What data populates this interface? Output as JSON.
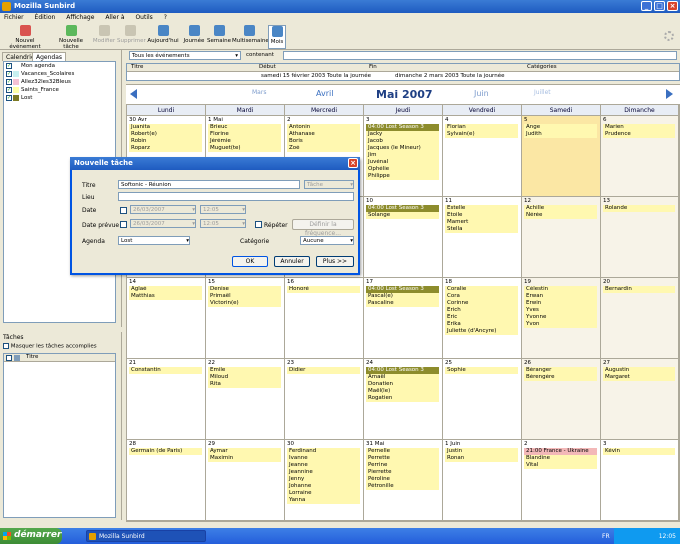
{
  "window": {
    "title": "Mozilla Sunbird"
  },
  "menu": [
    "Fichier",
    "Édition",
    "Affichage",
    "Aller à",
    "Outils",
    "?"
  ],
  "toolbar": [
    {
      "label": "Nouvel événement",
      "icon": "calendar-new-icon",
      "enabled": true
    },
    {
      "label": "Nouvelle tâche",
      "icon": "task-new-icon",
      "enabled": true
    },
    {
      "label": "Modifier",
      "icon": "edit-icon",
      "enabled": false
    },
    {
      "label": "Supprimer",
      "icon": "delete-icon",
      "enabled": false
    },
    {
      "label": "Aujourd'hui",
      "icon": "today-icon",
      "enabled": true
    },
    {
      "label": "Journée",
      "icon": "day-view-icon",
      "enabled": true
    },
    {
      "label": "Semaine",
      "icon": "week-view-icon",
      "enabled": true
    },
    {
      "label": "Multisemaine",
      "icon": "multiweek-view-icon",
      "enabled": true
    },
    {
      "label": "Mois",
      "icon": "month-view-icon",
      "enabled": true,
      "selected": true
    }
  ],
  "left": {
    "tabs": [
      "Calendrier",
      "Agendas"
    ],
    "active_tab": "Agendas",
    "calendars": [
      {
        "name": "Mon agenda",
        "color": "#ffffff"
      },
      {
        "name": "Vacances_Scolaires",
        "color": "#c7f0f0"
      },
      {
        "name": "Allez32les32Bleus",
        "color": "#f4c1d4"
      },
      {
        "name": "Saints_France",
        "color": "#ffffa8"
      },
      {
        "name": "Lost",
        "color": "#7d7a24"
      }
    ]
  },
  "tasks": {
    "title": "Tâches",
    "show_completed": "Masquer les tâches accomplies",
    "column": "Titre"
  },
  "filter": {
    "scope": "Tous les événements",
    "match": "contenant",
    "query": ""
  },
  "list": {
    "columns": [
      "Titre",
      "Début",
      "Fin",
      "Catégories"
    ],
    "row": {
      "start": "samedi 15 février 2003 Toute la journée",
      "end": "dimanche 2 mars 2003 Toute la journée"
    }
  },
  "month_nav": {
    "prev2": "Mars",
    "prev1": "Avril",
    "current": "Mai 2007",
    "next1": "Juin",
    "next2": "Juillet"
  },
  "weekdays": [
    "Lundi",
    "Mardi",
    "Mercredi",
    "Jeudi",
    "Vendredi",
    "Samedi",
    "Dimanche"
  ],
  "weeks": [
    [
      {
        "n": "30 Avr",
        "ev": [
          "Juanita",
          "Robert(e)",
          "Robin",
          "Roparz"
        ]
      },
      {
        "n": "1 Mai",
        "ev": [
          "Brieuc",
          "Florine",
          "Jérémie",
          "Muguet(te)"
        ]
      },
      {
        "n": "2",
        "ev": [
          "Antonin",
          "Athanase",
          "Boris",
          "Zoé"
        ]
      },
      {
        "n": "3",
        "ev": [
          {
            "t": "04:00 Lost Season 3",
            "k": "dark"
          },
          "Jacky",
          "Jacob",
          "Jacques (le Mineur)",
          "Jim",
          "Juvénal",
          "Ophélie",
          "Philippe"
        ]
      },
      {
        "n": "4",
        "ev": [
          "Florian",
          "Sylvain(e)"
        ]
      },
      {
        "n": "5",
        "ev": [
          "Ange",
          "Judith"
        ],
        "today": true
      },
      {
        "n": "6",
        "ev": [
          "Marien",
          "Prudence"
        ]
      }
    ],
    [
      {
        "n": "7",
        "ev": []
      },
      {
        "n": "8",
        "ev": []
      },
      {
        "n": "9",
        "ev": []
      },
      {
        "n": "10",
        "ev": [
          {
            "t": "04:00 Lost Season 3",
            "k": "dark"
          },
          "Solange"
        ]
      },
      {
        "n": "11",
        "ev": [
          "Estelle",
          "Etoile",
          "Mamert",
          "Stella"
        ]
      },
      {
        "n": "12",
        "ev": [
          "Achille",
          "Nérée"
        ]
      },
      {
        "n": "13",
        "ev": [
          "Rolande"
        ]
      }
    ],
    [
      {
        "n": "14",
        "ev": [
          "Aglaé",
          "Matthias"
        ]
      },
      {
        "n": "15",
        "ev": [
          "Denise",
          "Primaël",
          "Victorin(e)"
        ]
      },
      {
        "n": "16",
        "ev": [
          "Honoré"
        ]
      },
      {
        "n": "17",
        "ev": [
          {
            "t": "04:00 Lost Season 3",
            "k": "dark"
          },
          "Pascal(e)",
          "Pascaline"
        ]
      },
      {
        "n": "18",
        "ev": [
          "Coralie",
          "Cora",
          "Corinne",
          "Erich",
          "Eric",
          "Erika",
          "Juliette (d'Ancyre)"
        ]
      },
      {
        "n": "19",
        "ev": [
          "Célestin",
          "Erwan",
          "Erwin",
          "Yves",
          "Yvonne",
          "Yvon"
        ]
      },
      {
        "n": "20",
        "ev": [
          "Bernardin"
        ]
      }
    ],
    [
      {
        "n": "21",
        "ev": [
          "Constantin"
        ]
      },
      {
        "n": "22",
        "ev": [
          "Emile",
          "Miloud",
          "Rita"
        ]
      },
      {
        "n": "23",
        "ev": [
          "Didier"
        ]
      },
      {
        "n": "24",
        "ev": [
          {
            "t": "04:00 Lost Season 3",
            "k": "dark"
          },
          "Amaël",
          "Donatien",
          "Maël(le)",
          "Rogatien"
        ]
      },
      {
        "n": "25",
        "ev": [
          "Sophie"
        ]
      },
      {
        "n": "26",
        "ev": [
          "Béranger",
          "Bérengère"
        ]
      },
      {
        "n": "27",
        "ev": [
          "Augustin",
          "Margaret"
        ]
      }
    ],
    [
      {
        "n": "28",
        "ev": [
          "Germain (de Paris)"
        ]
      },
      {
        "n": "29",
        "ev": [
          "Aymar",
          "Maximin"
        ]
      },
      {
        "n": "30",
        "ev": [
          "Ferdinand",
          "Ivanne",
          "Jeanne",
          "Jeannine",
          "Jenny",
          "Johanne",
          "Lorraine",
          "Yanna"
        ]
      },
      {
        "n": "31 Mai",
        "ev": [
          "Pernelle",
          "Perrette",
          "Perrine",
          "Pierrette",
          "Péroline",
          "Pétronille"
        ]
      },
      {
        "n": "1 Juin",
        "ev": [
          "Justin",
          "Ronan"
        ],
        "other": true
      },
      {
        "n": "2",
        "ev": [
          {
            "t": "21:00 France - Ukraine",
            "k": "red"
          },
          "Blandine",
          "Vital"
        ],
        "other": true
      },
      {
        "n": "3",
        "ev": [
          "Kévin"
        ],
        "other": true
      }
    ]
  ],
  "dialog": {
    "title": "Nouvelle tâche",
    "labels": {
      "title": "Titre",
      "place": "Lieu",
      "date": "Date",
      "due": "Date prévue",
      "calendar": "Agenda",
      "category": "Catégorie"
    },
    "title_value": "Softonic - Réunion",
    "type_value": "Tâche",
    "date_value": "26/03/2007",
    "time_value": "12:05",
    "due_value": "26/03/2007",
    "due_time_value": "12:05",
    "repeat_label": "Répéter",
    "recurrence_label": "Définir la fréquence...",
    "calendar_value": "Lost",
    "category_value": "Aucune",
    "ok": "OK",
    "cancel": "Annuler",
    "more": "Plus >>"
  },
  "taskbar": {
    "start": "démarrer",
    "item": "Mozilla Sunbird",
    "lang": "FR",
    "clock": "12:05"
  }
}
